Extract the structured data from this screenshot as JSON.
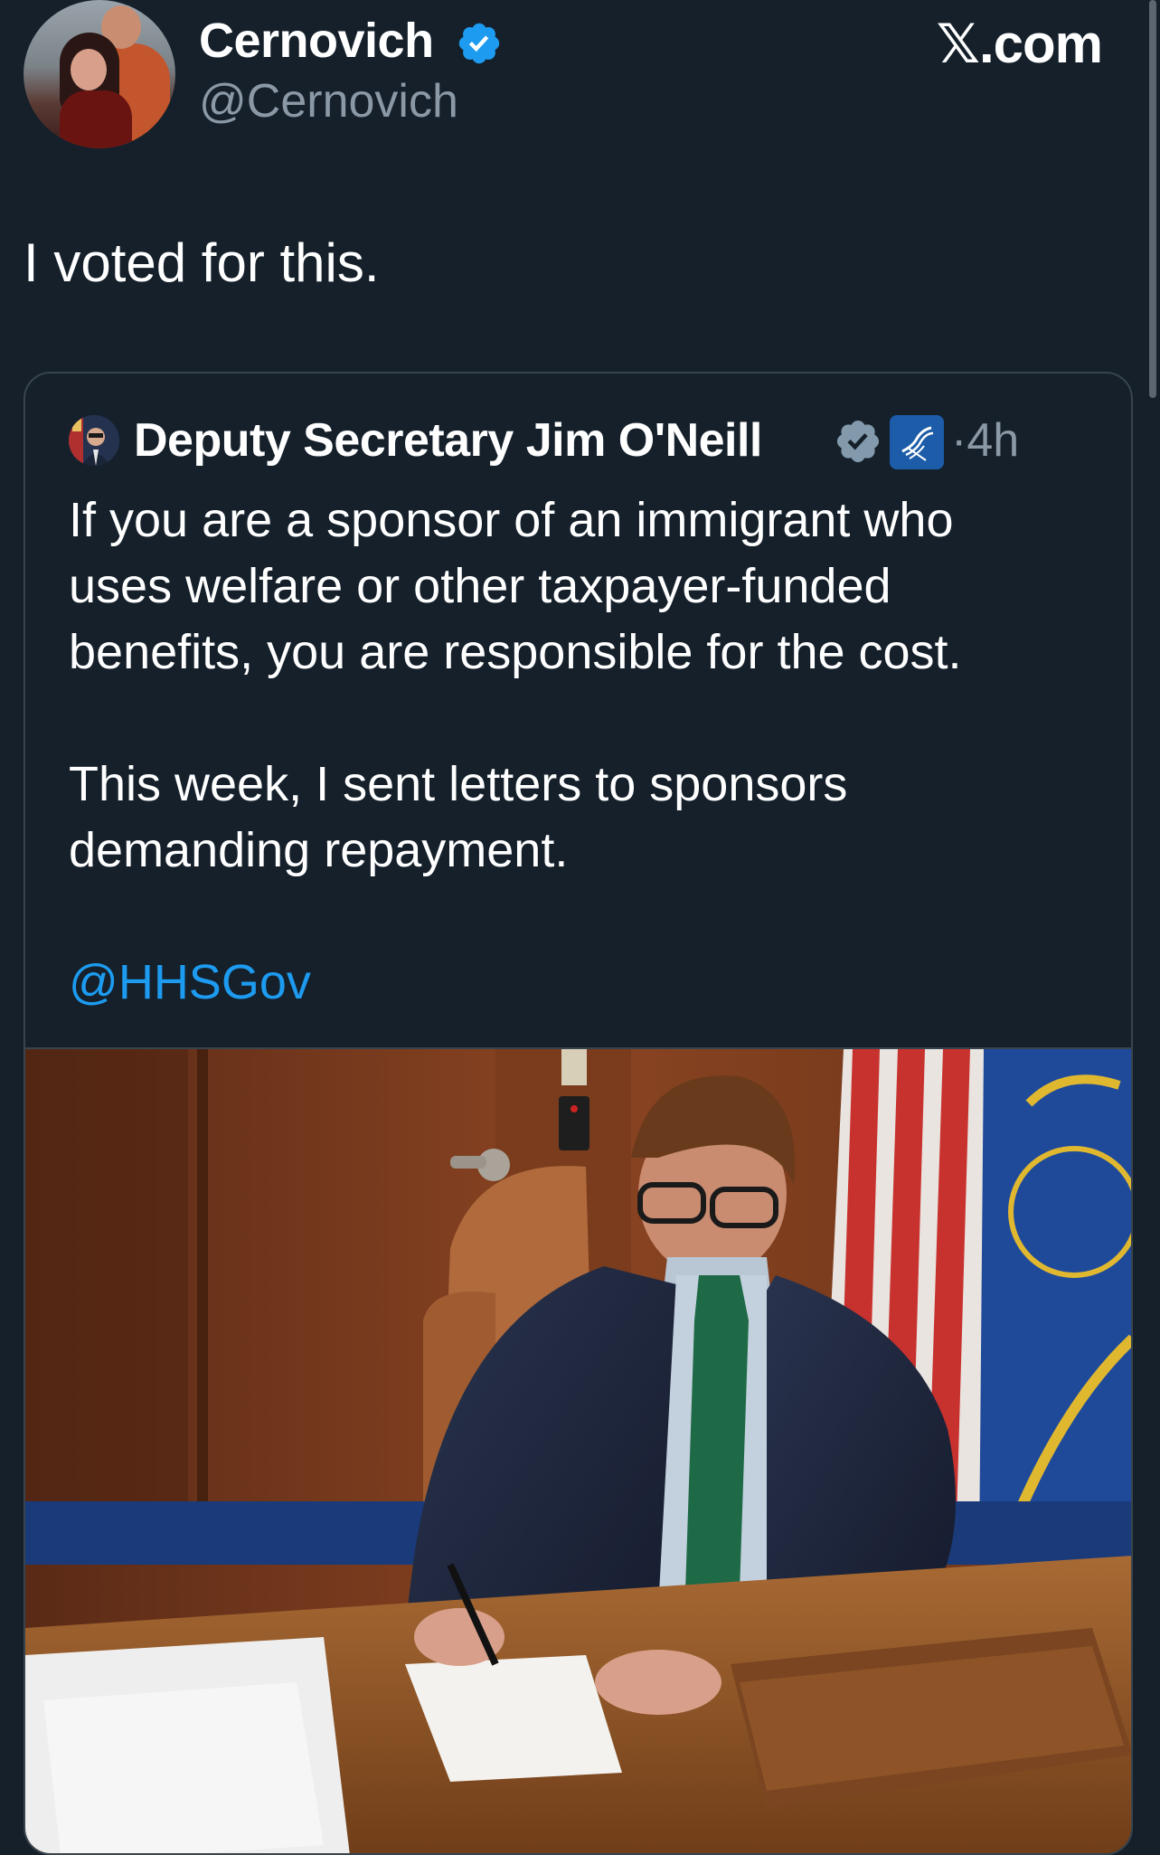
{
  "app": {
    "brand_label": "𝕏.com"
  },
  "tweet": {
    "author_name": "Cernovich",
    "author_handle": "@Cernovich",
    "text": "I voted for this."
  },
  "quoted_tweet": {
    "author_name": "Deputy Secretary Jim O'Neill",
    "time": "·4h",
    "paragraphs": [
      "If you are a sponsor of an immigrant who",
      "uses welfare or other taxpayer-funded",
      "benefits, you are responsible for the cost.",
      "This week, I sent letters to sponsors",
      "demanding repayment."
    ],
    "mention": "@HHSGov",
    "photo_icon": "photo-of-man-signing-documents-at-desk"
  },
  "colors": {
    "background": "#15202b",
    "text": "#ffffff",
    "secondary_text": "#8b98a5",
    "link": "#1d9bf0",
    "verified_blue": "#1d9bf0",
    "verified_gray": "#829aab",
    "border": "#38444d"
  }
}
